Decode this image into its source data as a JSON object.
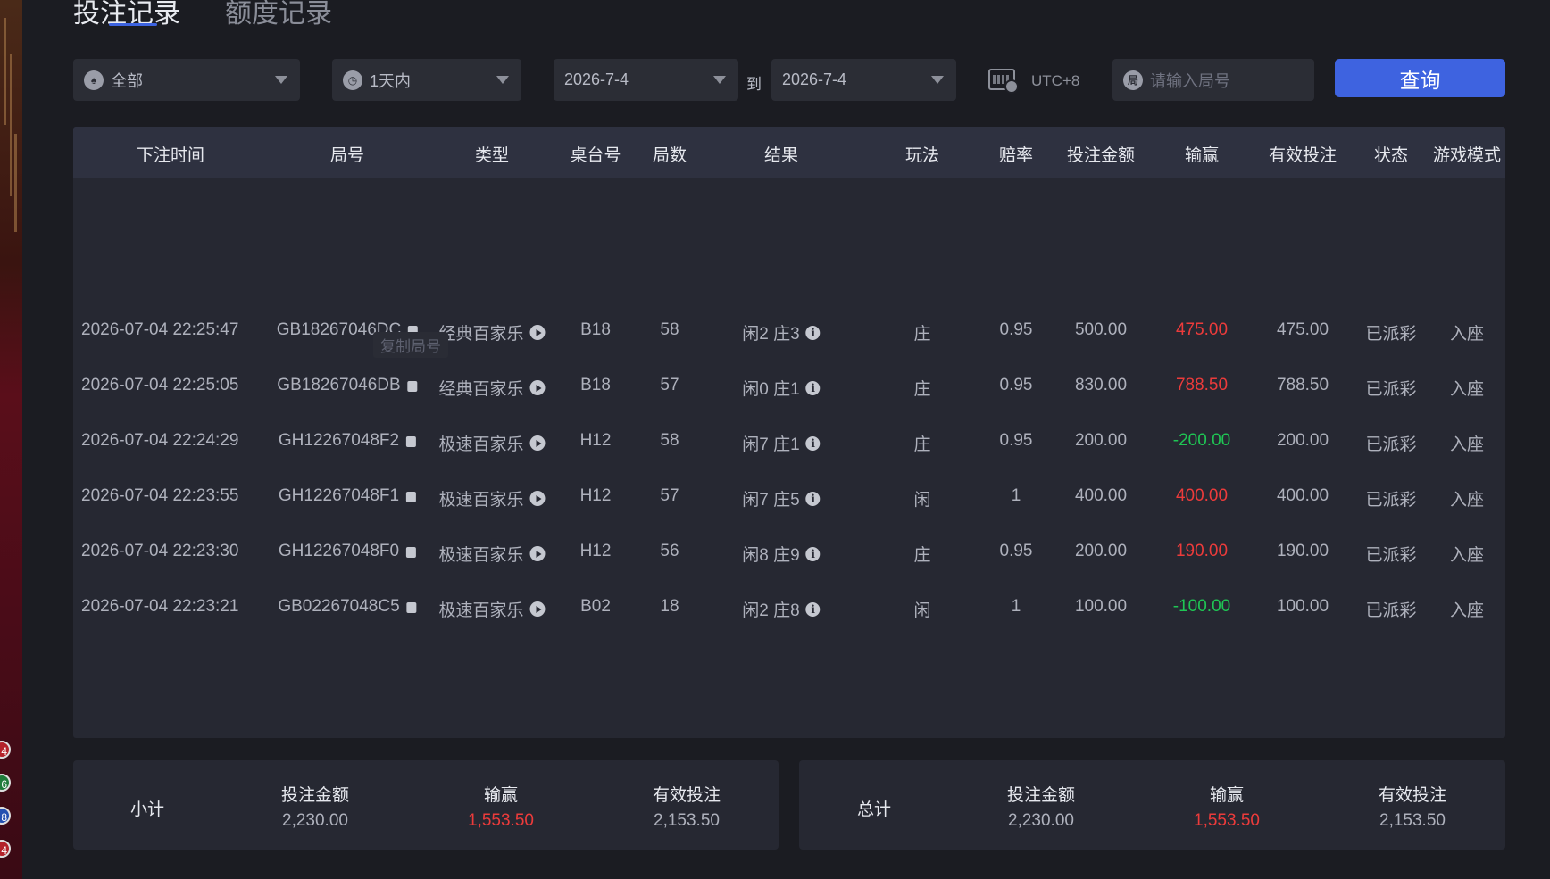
{
  "tabs": [
    {
      "label": "投注记录",
      "active": true
    },
    {
      "label": "额度记录",
      "active": false
    }
  ],
  "filters": {
    "game_select": "全部",
    "time_range": "1天内",
    "start_date": "2026-7-4",
    "to_label": "到",
    "end_date": "2026-7-4",
    "timezone": "UTC+8",
    "round_icon_glyph": "局",
    "round_placeholder": "请输入局号",
    "query_label": "查询"
  },
  "table": {
    "columns": [
      "下注时间",
      "局号",
      "类型",
      "桌台号",
      "局数",
      "结果",
      "玩法",
      "赔率",
      "投注金额",
      "输赢",
      "有效投注",
      "状态",
      "游戏模式"
    ],
    "rows": [
      {
        "time": "2026-07-04 22:25:47",
        "round": "GB18267046DC",
        "type": "经典百家乐",
        "table": "B18",
        "num": "58",
        "result": "闲2 庄3",
        "play": "庄",
        "odds": "0.95",
        "bet": "500.00",
        "winloss": "475.00",
        "valid": "475.00",
        "status": "已派彩",
        "mode": "入座"
      },
      {
        "time": "2026-07-04 22:25:05",
        "round": "GB18267046DB",
        "type": "经典百家乐",
        "table": "B18",
        "num": "57",
        "result": "闲0 庄1",
        "play": "庄",
        "odds": "0.95",
        "bet": "830.00",
        "winloss": "788.50",
        "valid": "788.50",
        "status": "已派彩",
        "mode": "入座"
      },
      {
        "time": "2026-07-04 22:24:29",
        "round": "GH12267048F2",
        "type": "极速百家乐",
        "table": "H12",
        "num": "58",
        "result": "闲7 庄1",
        "play": "庄",
        "odds": "0.95",
        "bet": "200.00",
        "winloss": "-200.00",
        "valid": "200.00",
        "status": "已派彩",
        "mode": "入座"
      },
      {
        "time": "2026-07-04 22:23:55",
        "round": "GH12267048F1",
        "type": "极速百家乐",
        "table": "H12",
        "num": "57",
        "result": "闲7 庄5",
        "play": "闲",
        "odds": "1",
        "bet": "400.00",
        "winloss": "400.00",
        "valid": "400.00",
        "status": "已派彩",
        "mode": "入座"
      },
      {
        "time": "2026-07-04 22:23:30",
        "round": "GH12267048F0",
        "type": "极速百家乐",
        "table": "H12",
        "num": "56",
        "result": "闲8 庄9",
        "play": "庄",
        "odds": "0.95",
        "bet": "200.00",
        "winloss": "190.00",
        "valid": "190.00",
        "status": "已派彩",
        "mode": "入座"
      },
      {
        "time": "2026-07-04 22:23:21",
        "round": "GB02267048C5",
        "type": "极速百家乐",
        "table": "B02",
        "num": "18",
        "result": "闲2 庄8",
        "play": "闲",
        "odds": "1",
        "bet": "100.00",
        "winloss": "-100.00",
        "valid": "100.00",
        "status": "已派彩",
        "mode": "入座"
      }
    ],
    "tooltip": "复制局号"
  },
  "summary": {
    "subtotal": {
      "label": "小计",
      "bet_label": "投注金额",
      "bet": "2,230.00",
      "winloss_label": "输赢",
      "winloss": "1,553.50",
      "valid_label": "有效投注",
      "valid": "2,153.50"
    },
    "total": {
      "label": "总计",
      "bet_label": "投注金额",
      "bet": "2,230.00",
      "winloss_label": "输赢",
      "winloss": "1,553.50",
      "valid_label": "有效投注",
      "valid": "2,153.50"
    }
  },
  "side_chips": [
    "4",
    "6",
    "8",
    "4"
  ],
  "colors": {
    "accent": "#3e63e0",
    "win": "#ec3b3b",
    "loss": "#1fc654"
  }
}
